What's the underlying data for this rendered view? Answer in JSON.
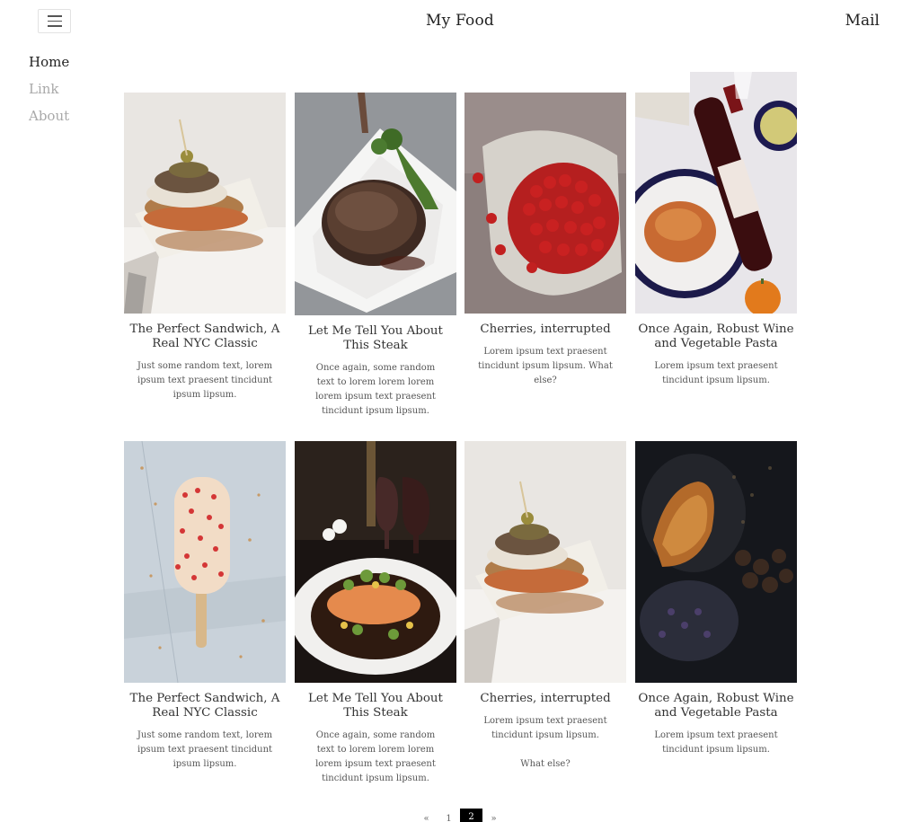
{
  "header": {
    "site_title": "My Food",
    "mail_label": "Mail",
    "menu_icon": "hamburger-icon"
  },
  "sidebar": {
    "items": [
      {
        "label": "Home"
      },
      {
        "label": "Link"
      },
      {
        "label": "About"
      }
    ]
  },
  "posts": [
    {
      "title": "The Perfect Sandwich, A Real NYC Classic",
      "text": "Just some random text, lorem ipsum text praesent tincidunt ipsum lipsum."
    },
    {
      "title": "Let Me Tell You About This Steak",
      "text": "Once again, some random text to lorem lorem lorem lorem ipsum text praesent tincidunt ipsum lipsum."
    },
    {
      "title": "Cherries, interrupted",
      "text": "Lorem ipsum text praesent tincidunt ipsum lipsum. What else?"
    },
    {
      "title": "Once Again, Robust Wine and Vegetable Pasta",
      "text": "Lorem ipsum text praesent tincidunt ipsum lipsum."
    },
    {
      "title": "The Perfect Sandwich, A Real NYC Classic",
      "text": "Just some random text, lorem ipsum text praesent tincidunt ipsum lipsum."
    },
    {
      "title": "Let Me Tell You About This Steak",
      "text": "Once again, some random text to lorem lorem lorem lorem ipsum text praesent tincidunt ipsum lipsum."
    },
    {
      "title": "Cherries, interrupted",
      "text": "Lorem ipsum text praesent tincidunt ipsum lipsum.",
      "text2": "What else?"
    },
    {
      "title": "Once Again, Robust Wine and Vegetable Pasta",
      "text": "Lorem ipsum text praesent tincidunt ipsum lipsum."
    }
  ],
  "pagination": {
    "prev": "«",
    "pages": [
      "1",
      "2"
    ],
    "current": "2",
    "next": "»"
  }
}
